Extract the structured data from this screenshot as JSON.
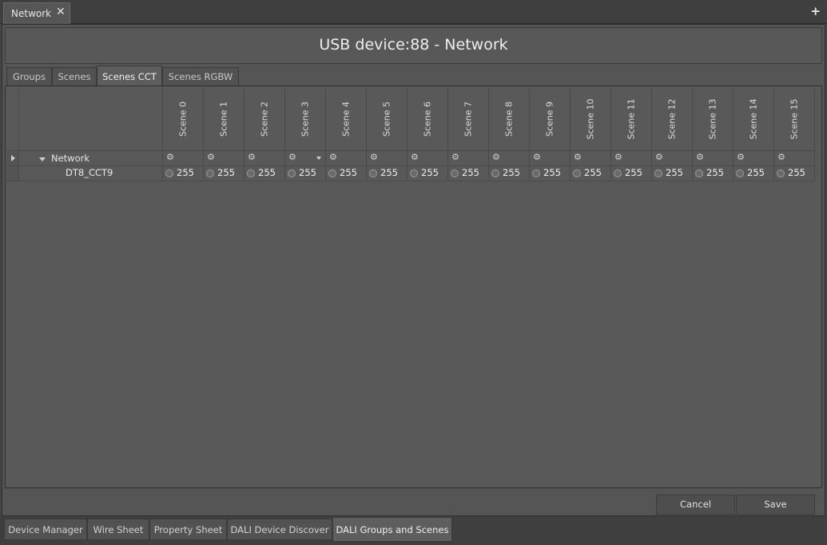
{
  "top_tab": {
    "label": "Network",
    "close_glyph": "✕",
    "add_glyph": "+"
  },
  "title": "USB device:88 - Network",
  "inner_tabs": [
    {
      "label": "Groups",
      "active": false
    },
    {
      "label": "Scenes",
      "active": false
    },
    {
      "label": "Scenes CCT",
      "active": true
    },
    {
      "label": "Scenes RGBW",
      "active": false
    }
  ],
  "grid": {
    "scene_headers": [
      "Scene 0",
      "Scene 1",
      "Scene 2",
      "Scene 3",
      "Scene 4",
      "Scene 5",
      "Scene 6",
      "Scene 7",
      "Scene 8",
      "Scene 9",
      "Scene 10",
      "Scene 11",
      "Scene 12",
      "Scene 13",
      "Scene 14",
      "Scene 15"
    ],
    "network_row": {
      "label": "Network",
      "cell_icon": "gear-icon",
      "dropdown_scene_index": 3
    },
    "device_row": {
      "label": "DT8_CCT9",
      "values": [
        "255",
        "255",
        "255",
        "255",
        "255",
        "255",
        "255",
        "255",
        "255",
        "255",
        "255",
        "255",
        "255",
        "255",
        "255",
        "255"
      ]
    }
  },
  "buttons": {
    "cancel": "Cancel",
    "save": "Save"
  },
  "bottom_tabs": [
    {
      "label": "Device Manager",
      "active": false
    },
    {
      "label": "Wire Sheet",
      "active": false
    },
    {
      "label": "Property Sheet",
      "active": false
    },
    {
      "label": "DALI Device Discover",
      "active": false
    },
    {
      "label": "DALI Groups and Scenes",
      "active": true
    }
  ],
  "colors": {
    "background": "#454545",
    "panel": "#595959",
    "text": "#d8d8d8"
  }
}
